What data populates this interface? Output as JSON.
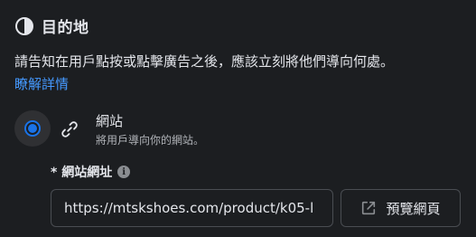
{
  "header": {
    "title": "目的地",
    "icon": "half-circle-icon"
  },
  "description": {
    "text": "請告知在用戶點按或點擊廣告之後，應該立刻將他們導向何處。",
    "learn_more": "瞭解詳情"
  },
  "option": {
    "selected": true,
    "icon": "link-icon",
    "title": "網站",
    "subtitle": "將用戶導向你的網站。"
  },
  "url_field": {
    "label": "* 網站網址",
    "value": "https://mtskshoes.com/product/k05-l",
    "info_icon": "info-icon"
  },
  "preview_button": {
    "label": "預覽網頁",
    "icon": "external-link-icon"
  },
  "colors": {
    "background": "#1c1e21",
    "accent": "#1a73e8",
    "link": "#4599ff",
    "text": "#e4e6eb",
    "muted": "#b0b3b8"
  }
}
